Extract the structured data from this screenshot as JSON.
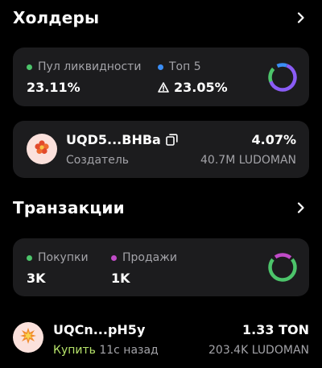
{
  "holders": {
    "title": "Холдеры",
    "liquidity_label": "Пул ликвидности",
    "liquidity_value": "23.11%",
    "top_label": "Топ 5",
    "top_value": "23.05%",
    "liquidity_color": "#4cc46a",
    "top_color": "#3a8ef6",
    "ring_color": "#8a5cf5"
  },
  "creator": {
    "address": "UQD5...BHBa",
    "role": "Создатель",
    "percent": "4.07%",
    "amount": "40.7M LUDOMAN",
    "avatar_icon": "flower-icon"
  },
  "transactions": {
    "title": "Транзакции",
    "buys_label": "Покупки",
    "buys_value": "3K",
    "sells_label": "Продажи",
    "sells_value": "1K",
    "buys_color": "#4cc46a",
    "sells_color": "#c04bc7"
  },
  "tx": {
    "address": "UQCn...pH5y",
    "action": "Купить",
    "time": "11с назад",
    "ton": "1.33 TON",
    "amount": "203.4K LUDOMAN",
    "avatar_icon": "explosion-icon"
  }
}
